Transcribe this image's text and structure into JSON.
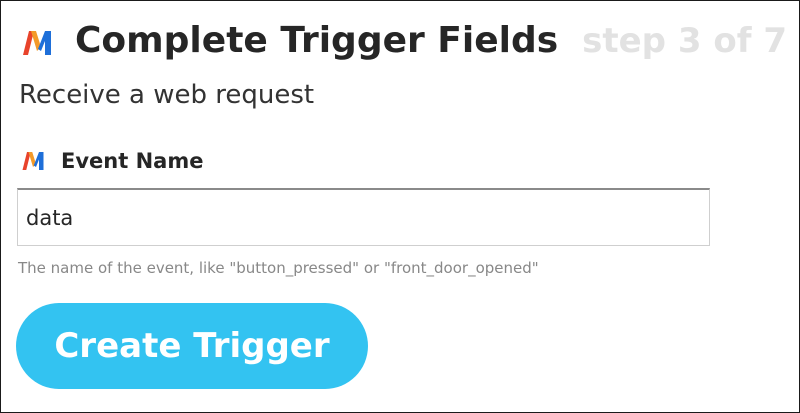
{
  "header": {
    "title": "Complete Trigger Fields",
    "step": "step 3 of 7",
    "logo_icon": "maker-logo-icon"
  },
  "subtitle": "Receive a web request",
  "field": {
    "icon": "maker-logo-icon",
    "label": "Event Name",
    "value": "data",
    "helper": "The name of the event, like \"button_pressed\" or \"front_door_opened\""
  },
  "button": {
    "label": "Create Trigger"
  },
  "colors": {
    "button_bg": "#33c3f1",
    "step_text": "#e2e2e2",
    "logo_red": "#e8432b",
    "logo_blue": "#1e6fd9",
    "logo_orange": "#f39a2a"
  }
}
